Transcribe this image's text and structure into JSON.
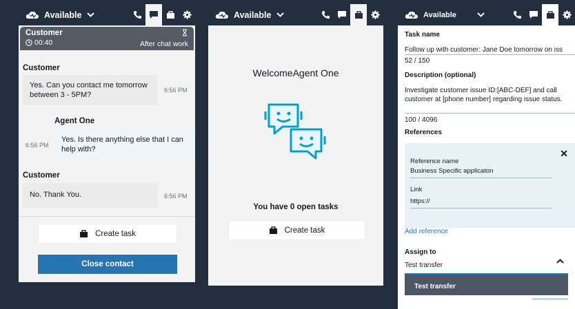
{
  "topbar": {
    "status_label": "Available",
    "tab_icons": [
      "phone-icon",
      "chat-icon",
      "briefcase-icon",
      "gear-icon"
    ]
  },
  "panel1": {
    "contact": {
      "name": "Customer",
      "timer": "00:40",
      "state": "After chat work"
    },
    "messages": [
      {
        "sender": "Customer",
        "text": "Yes. Can you contact me tomorrow between 3 - 5PM?",
        "time": "6:56 PM"
      },
      {
        "sender": "Agent One",
        "text": "Yes. Is there anything else that I can help with?",
        "time": "6:56 PM"
      },
      {
        "sender": "Customer",
        "text": "No. Thank You.",
        "time": "6:56 PM"
      }
    ],
    "create_task_label": "Create task",
    "close_contact_label": "Close contact"
  },
  "panel2": {
    "welcome": "WelcomeAgent One",
    "open_tasks_prefix": "You have ",
    "open_tasks_count": "0",
    "open_tasks_suffix": " open tasks",
    "create_task_label": "Create task"
  },
  "panel3": {
    "task_name_label": "Task name",
    "task_name_value": "Follow up with customer: Jane Doe tomorrow on iss",
    "task_name_count": "52 / 150",
    "description_label": "Description (optional)",
    "description_value": "Investigate customer issue ID:[ABC-DEF] and call customer at [phone number] regarding issue status.",
    "description_count": "100 / 4096",
    "references_label": "References",
    "reference_name_label": "Reference name",
    "reference_name_value": "Business Specific applicaton",
    "link_label": "Link",
    "link_value": "https://",
    "add_reference_label": "Add reference",
    "assign_to_label": "Assign to",
    "assign_to_value": "Test transfer",
    "assign_option": "Test transfer"
  },
  "colors": {
    "navy": "#232f3e",
    "blue": "#2874b0",
    "teal": "#4fc3d0"
  }
}
